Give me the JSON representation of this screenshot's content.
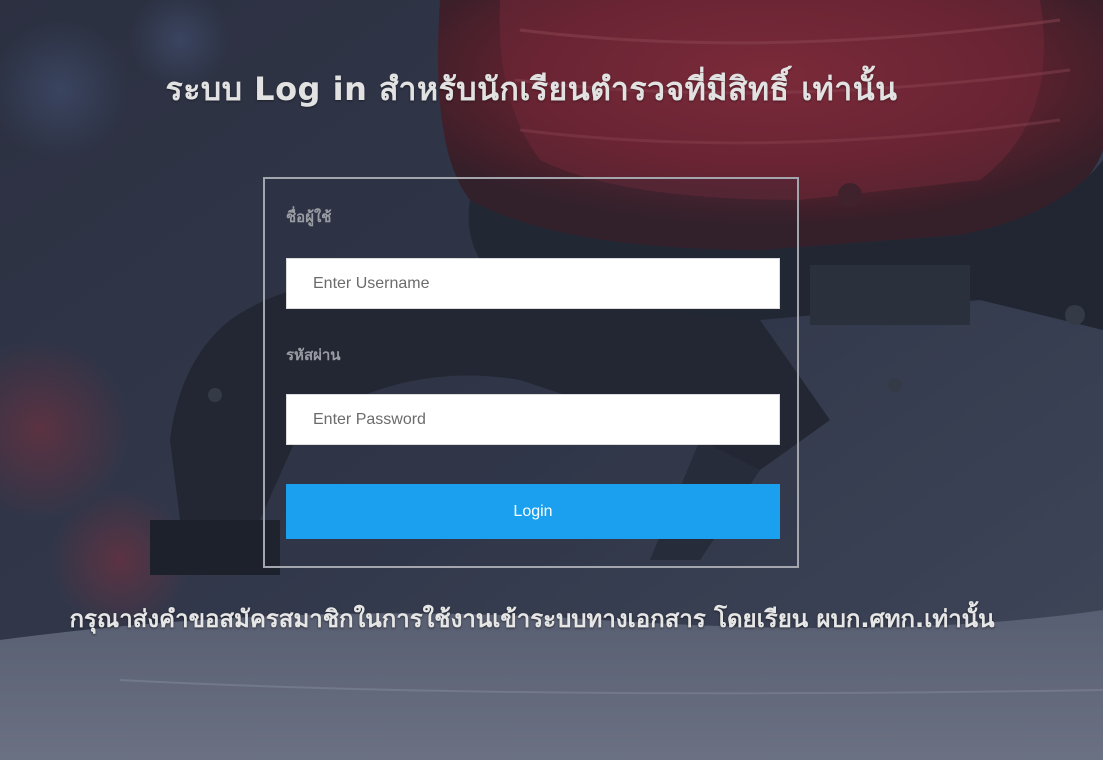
{
  "header": {
    "title": "ระบบ Log in สำหรับนักเรียนตำรวจที่มีสิทธิ์ เท่านั้น"
  },
  "login_form": {
    "username_label": "ชื่อผู้ใช้",
    "username_placeholder": "Enter Username",
    "username_value": "",
    "password_label": "รหัสผ่าน",
    "password_placeholder": "Enter Password",
    "password_value": "",
    "login_button_label": "Login"
  },
  "footer": {
    "notice": "กรุณาส่งคำขอสมัครสมาชิกในการใช้งานเข้าระบบทางเอกสาร โดยเรียน ผบก.ศทก.เท่านั้น"
  },
  "colors": {
    "button_background": "#1aa0ee",
    "panel_border": "#a4a6ad",
    "background_dark": "#2a3142",
    "siren_red": "#8b1a24"
  }
}
